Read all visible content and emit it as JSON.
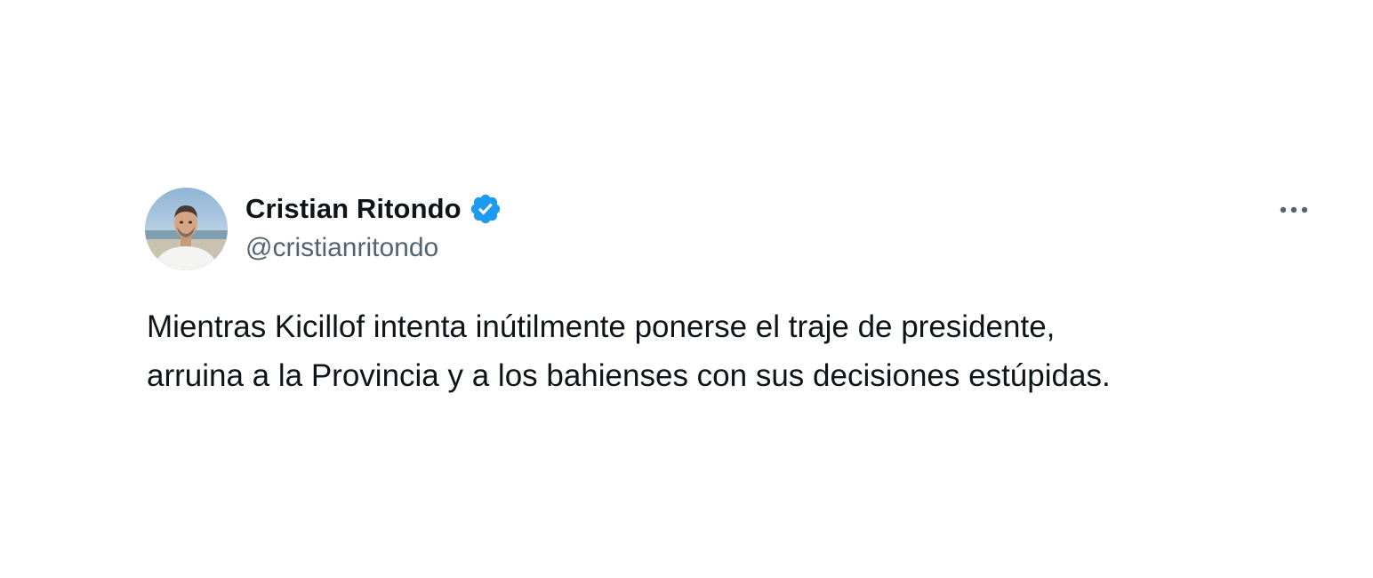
{
  "tweet": {
    "author": {
      "display_name": "Cristian Ritondo",
      "handle": "@cristianritondo",
      "verified": true,
      "avatar_icon": "profile-photo"
    },
    "more_icon": "more-horizontal-icon",
    "text_lines": [
      "Mientras Kicillof intenta inútilmente ponerse el traje de presidente,",
      "arruina a la Provincia y a los bahienses con sus decisiones estúpidas."
    ]
  },
  "colors": {
    "text_primary": "#0f1419",
    "text_secondary": "#536471",
    "verified_badge": "#1d9bf0",
    "background": "#ffffff"
  }
}
